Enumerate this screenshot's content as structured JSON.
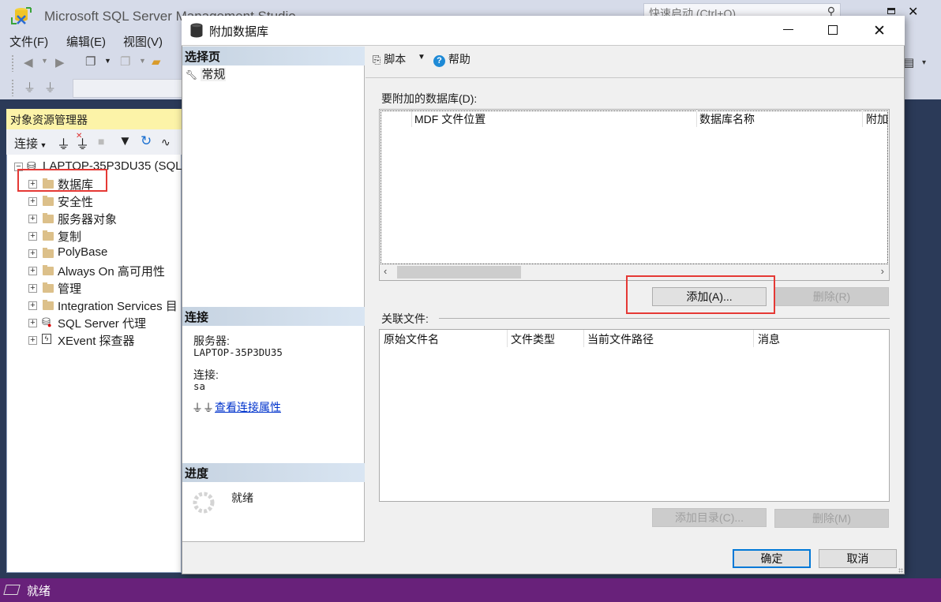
{
  "app": {
    "title": "Microsoft SQL Server Management Studio",
    "quick_launch_placeholder": "快速启动 (Ctrl+Q)",
    "menu": [
      "文件(F)",
      "编辑(E)",
      "视图(V)"
    ]
  },
  "object_explorer": {
    "title": "对象资源管理器",
    "connect_label": "连接",
    "server_node": "LAPTOP-35P3DU35 (SQL",
    "nodes": [
      {
        "label": "数据库",
        "icon": "folder-icon",
        "highlighted": true
      },
      {
        "label": "安全性",
        "icon": "folder-icon"
      },
      {
        "label": "服务器对象",
        "icon": "folder-icon"
      },
      {
        "label": "复制",
        "icon": "folder-icon"
      },
      {
        "label": "PolyBase",
        "icon": "folder-icon"
      },
      {
        "label": "Always On 高可用性",
        "icon": "folder-icon"
      },
      {
        "label": "管理",
        "icon": "folder-icon"
      },
      {
        "label": "Integration Services 目",
        "icon": "folder-icon"
      },
      {
        "label": "SQL Server 代理",
        "icon": "agent-icon"
      },
      {
        "label": "XEvent 探查器",
        "icon": "xevent-icon"
      }
    ]
  },
  "dialog": {
    "title": "附加数据库",
    "select_page_header": "选择页",
    "pages": [
      "常规"
    ],
    "connection_header": "连接",
    "server_label": "服务器:",
    "server_value": "LAPTOP-35P3DU35",
    "connection_label": "连接:",
    "connection_value": "sa",
    "view_connection_link": "查看连接属性",
    "progress_header": "进度",
    "progress_status": "就绪",
    "toolbar": {
      "script_label": "脚本",
      "help_label": "帮助"
    },
    "databases_label": "要附加的数据库(D):",
    "databases_columns": [
      "MDF 文件位置",
      "数据库名称",
      "附加"
    ],
    "databases_rows": [],
    "add_button": "添加(A)...",
    "remove_button": "删除(R)",
    "related_files_label": "关联文件:",
    "files_columns": [
      "原始文件名",
      "文件类型",
      "当前文件路径",
      "消息"
    ],
    "files_rows": [],
    "add_catalog_button": "添加目录(C)...",
    "remove_file_button": "删除(M)",
    "ok_button": "确定",
    "cancel_button": "取消"
  },
  "status_bar": {
    "text": "就绪",
    "color": "#68217a"
  }
}
